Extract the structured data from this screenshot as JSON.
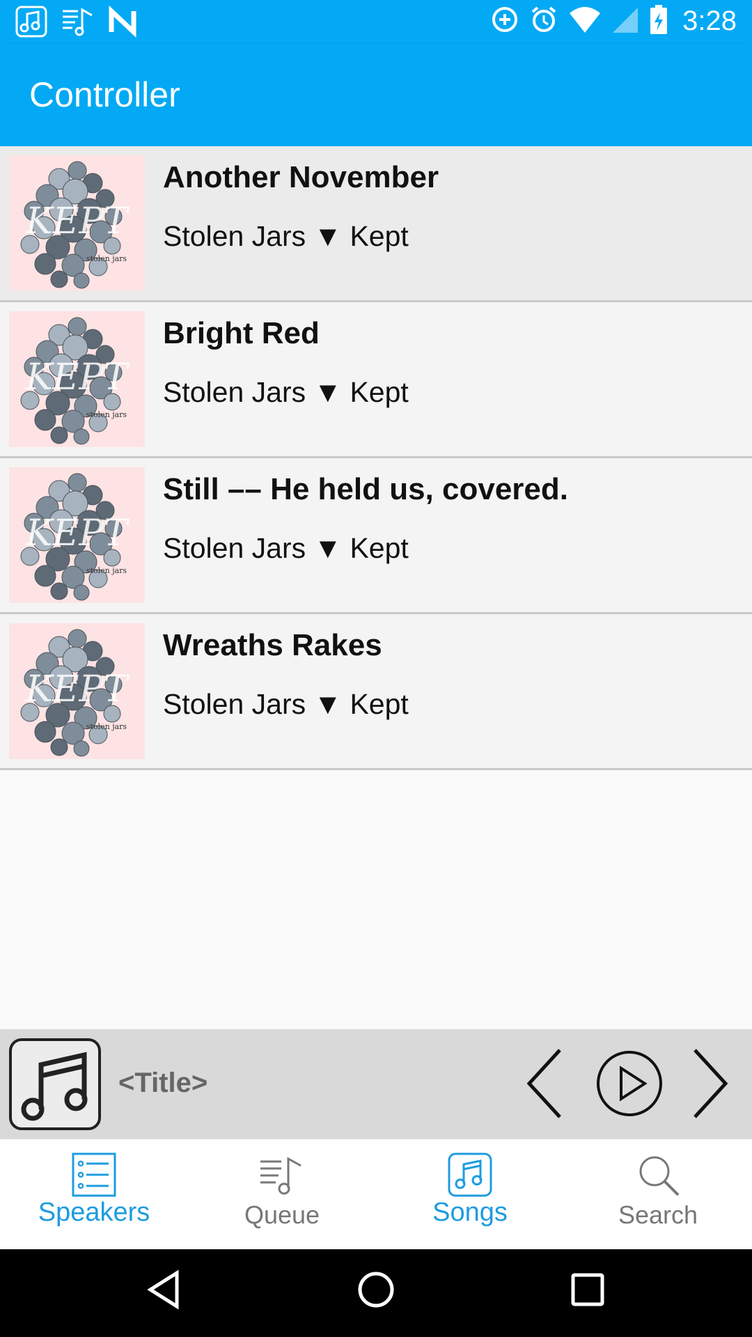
{
  "status_bar": {
    "time": "3:28",
    "left_icons": [
      "music-note-icon",
      "queue-music-icon",
      "n-logo-icon"
    ],
    "right_icons": [
      "data-saver-icon",
      "alarm-icon",
      "wifi-icon",
      "cell-signal-icon",
      "battery-charging-icon"
    ]
  },
  "app_bar": {
    "title": "Controller"
  },
  "songs": [
    {
      "title": "Another November",
      "subtitle": "Stolen Jars ▼ Kept",
      "selected": true
    },
    {
      "title": "Bright Red",
      "subtitle": "Stolen Jars ▼ Kept",
      "selected": false
    },
    {
      "title": "Still –– He held us, covered.",
      "subtitle": "Stolen Jars ▼ Kept",
      "selected": false
    },
    {
      "title": "Wreaths Rakes",
      "subtitle": "Stolen Jars ▼ Kept",
      "selected": false
    }
  ],
  "album_art": {
    "text": "KEPT",
    "small_text": "stolen jars"
  },
  "now_playing": {
    "title": "<Title>"
  },
  "tabs": [
    {
      "label": "Speakers",
      "icon": "list-icon",
      "active": true
    },
    {
      "label": "Queue",
      "icon": "queue-music-icon",
      "active": false
    },
    {
      "label": "Songs",
      "icon": "music-note-icon",
      "active": true
    },
    {
      "label": "Search",
      "icon": "search-icon",
      "active": false
    }
  ],
  "colors": {
    "primary": "#03a9f4",
    "tab_active": "#1e9ce0",
    "tab_inactive": "#777777",
    "nowplaying_bg": "#d9d9d9"
  }
}
